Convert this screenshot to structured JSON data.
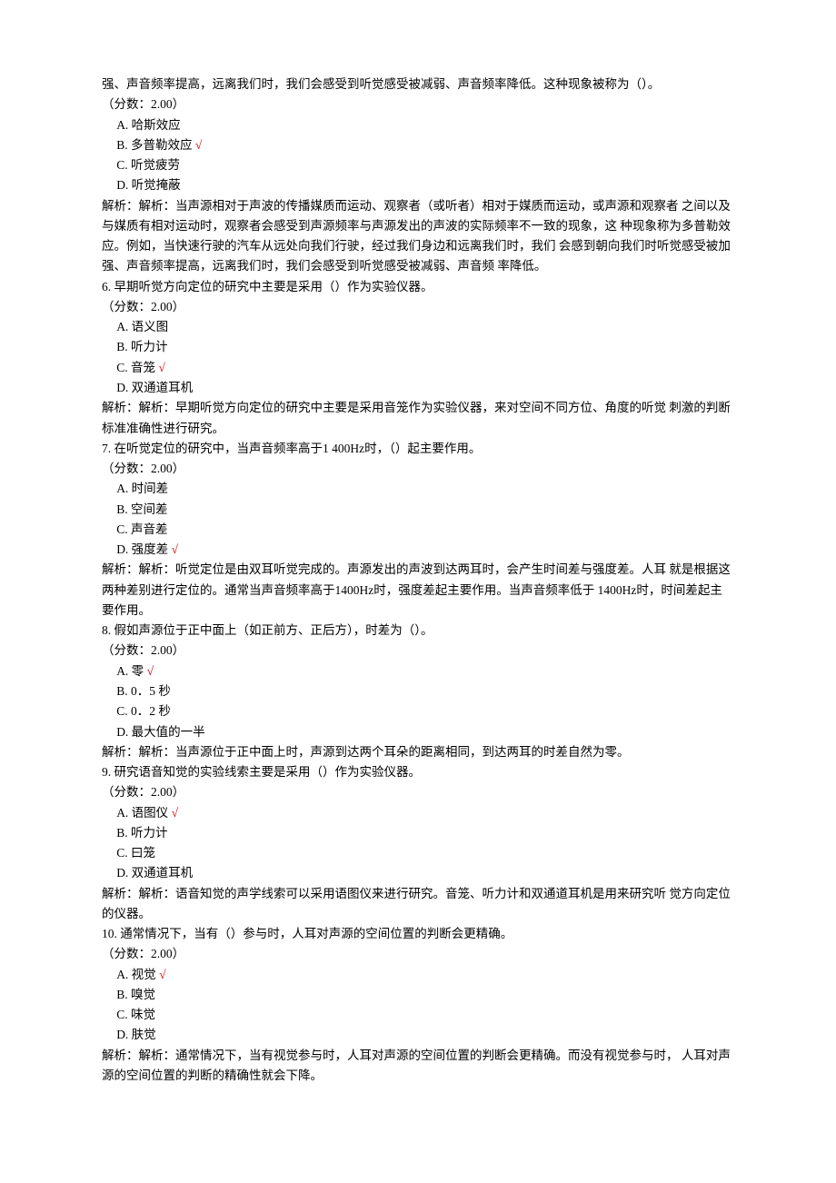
{
  "intro_cont": "强、声音频率提高，远离我们时，我们会感受到听觉感受被减弱、声音频率降低。这种现象被称为（）。",
  "score_label": "（分数：2.00）",
  "mark": "√",
  "q5": {
    "A": "A.  哈斯效应",
    "B": "B.  多普勒效应 ",
    "C": "C.  听觉疲劳",
    "D": "D.  听觉掩蔽",
    "analysis": "解析：解析：当声源相对于声波的传播媒质而运动、观察者（或听者）相对于媒质而运动，或声源和观察者 之间以及与媒质有相对运动时，观察者会感受到声源频率与声源发出的声波的实际频率不一致的现象，这 种现象称为多普勒效应。例如，当快速行驶的汽车从远处向我们行驶，经过我们身边和远离我们时，我们 会感到朝向我们时听觉感受被加强、声音频率提高，远离我们时，我们会感受到听觉感受被减弱、声音频 率降低。"
  },
  "q6": {
    "stem": "6.  早期听觉方向定位的研究中主要是采用（）作为实验仪器。",
    "A": "A.  语义图",
    "B": "B.  听力计",
    "C": "C.  音笼 ",
    "D": "D.  双通道耳机",
    "analysis": "解析：解析：早期听觉方向定位的研究中主要是采用音笼作为实验仪器，来对空间不同方位、角度的听觉 刺激的判断标准准确性进行研究。"
  },
  "q7": {
    "stem": "7.  在听觉定位的研究中，当声音频率高于1 400Hz时，（）起主要作用。",
    "A": "A.  时间差",
    "B": "B.  空间差",
    "C": "C.  声音差",
    "D": "D.  强度差 ",
    "analysis": "解析：解析：听觉定位是由双耳听觉完成的。声源发出的声波到达两耳时，会产生时间差与强度差。人耳 就是根据这两种差别进行定位的。通常当声音频率高于1400Hz时，强度差起主要作用。当声音频率低于 1400Hz时，时间差起主要作用。"
  },
  "q8": {
    "stem": "8.  假如声源位于正中面上（如正前方、正后方），时差为（）。",
    "A": "A.  零 ",
    "B": "B.  0．5 秒",
    "C": "C.  0．2 秒",
    "D": "D.  最大值的一半",
    "analysis": "解析：解析：当声源位于正中面上时，声源到达两个耳朵的距离相同，到达两耳的时差自然为零。"
  },
  "q9": {
    "stem": "9.  研究语音知觉的实验线索主要是采用（）作为实验仪器。",
    "A": "A.  语图仪 ",
    "B": "B.  听力计",
    "C": "C.  曰笼",
    "D": "D.  双通道耳机",
    "analysis": "解析：解析：语音知觉的声学线索可以采用语图仪来进行研究。音笼、听力计和双通道耳机是用来研究听 觉方向定位的仪器。"
  },
  "q10": {
    "stem": "10.   通常情况下，当有（）参与时，人耳对声源的空间位置的判断会更精确。",
    "A": "A.  视觉 ",
    "B": "B.  嗅觉",
    "C": "C.  味觉",
    "D": "D.  肤觉",
    "analysis": "解析：解析：通常情况下，当有视觉参与时，人耳对声源的空间位置的判断会更精确。而没有视觉参与时，  人耳对声源的空间位置的判断的精确性就会下降。"
  }
}
